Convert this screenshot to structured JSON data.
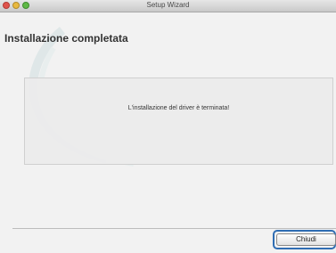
{
  "window": {
    "title": "Setup Wizard"
  },
  "page": {
    "heading": "Installazione completata",
    "message": "L'installazione del driver è terminata!"
  },
  "buttons": {
    "close_label": "Chiudi"
  },
  "colors": {
    "focus_ring": "#2f6db3",
    "window_bg": "#f2f2f2"
  }
}
